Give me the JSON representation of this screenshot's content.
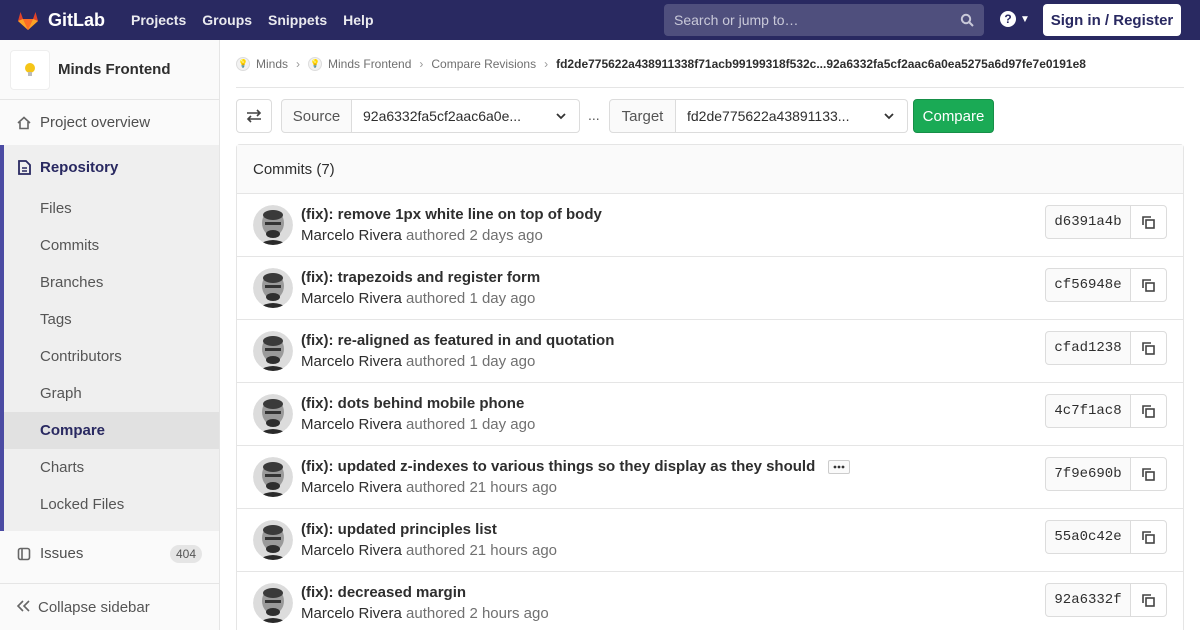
{
  "topbar": {
    "logo_text": "GitLab",
    "nav": [
      "Projects",
      "Groups",
      "Snippets",
      "Help"
    ],
    "search_placeholder": "Search or jump to…",
    "signin_label": "Sign in / Register"
  },
  "sidebar": {
    "project_name": "Minds Frontend",
    "overview_label": "Project overview",
    "repository_label": "Repository",
    "items": [
      "Files",
      "Commits",
      "Branches",
      "Tags",
      "Contributors",
      "Graph",
      "Compare",
      "Charts",
      "Locked Files"
    ],
    "active_item": "Compare",
    "issues_label": "Issues",
    "issues_count": "404",
    "collapse_label": "Collapse sidebar"
  },
  "breadcrumb": {
    "items": [
      "Minds",
      "Minds Frontend",
      "Compare Revisions"
    ],
    "current": "fd2de775622a438911338f71acb99199318f532c...92a6332fa5cf2aac6a0ea5275a6d97fe7e0191e8"
  },
  "compare": {
    "source_label": "Source",
    "source_value": "92a6332fa5cf2aac6a0e...",
    "separator": "...",
    "target_label": "Target",
    "target_value": "fd2de775622a43891133...",
    "compare_button": "Compare"
  },
  "commits": {
    "header": "Commits (7)",
    "list": [
      {
        "title": "(fix): remove 1px white line on top of body",
        "author": "Marcelo Rivera",
        "verb": "authored",
        "time": "2 days ago",
        "sha": "d6391a4b"
      },
      {
        "title": "(fix): trapezoids and register form",
        "author": "Marcelo Rivera",
        "verb": "authored",
        "time": "1 day ago",
        "sha": "cf56948e"
      },
      {
        "title": "(fix): re-aligned as featured in and quotation",
        "author": "Marcelo Rivera",
        "verb": "authored",
        "time": "1 day ago",
        "sha": "cfad1238"
      },
      {
        "title": "(fix): dots behind mobile phone",
        "author": "Marcelo Rivera",
        "verb": "authored",
        "time": "1 day ago",
        "sha": "4c7f1ac8"
      },
      {
        "title": "(fix): updated z-indexes to various things so they display as they should",
        "author": "Marcelo Rivera",
        "verb": "authored",
        "time": "21 hours ago",
        "sha": "7f9e690b",
        "has_more": true
      },
      {
        "title": "(fix): updated principles list",
        "author": "Marcelo Rivera",
        "verb": "authored",
        "time": "21 hours ago",
        "sha": "55a0c42e"
      },
      {
        "title": "(fix): decreased margin",
        "author": "Marcelo Rivera",
        "verb": "authored",
        "time": "2 hours ago",
        "sha": "92a6332f"
      }
    ]
  },
  "colors": {
    "topbar": "#292961",
    "accent": "#4b4ba3",
    "compare_button": "#1aaa55"
  }
}
